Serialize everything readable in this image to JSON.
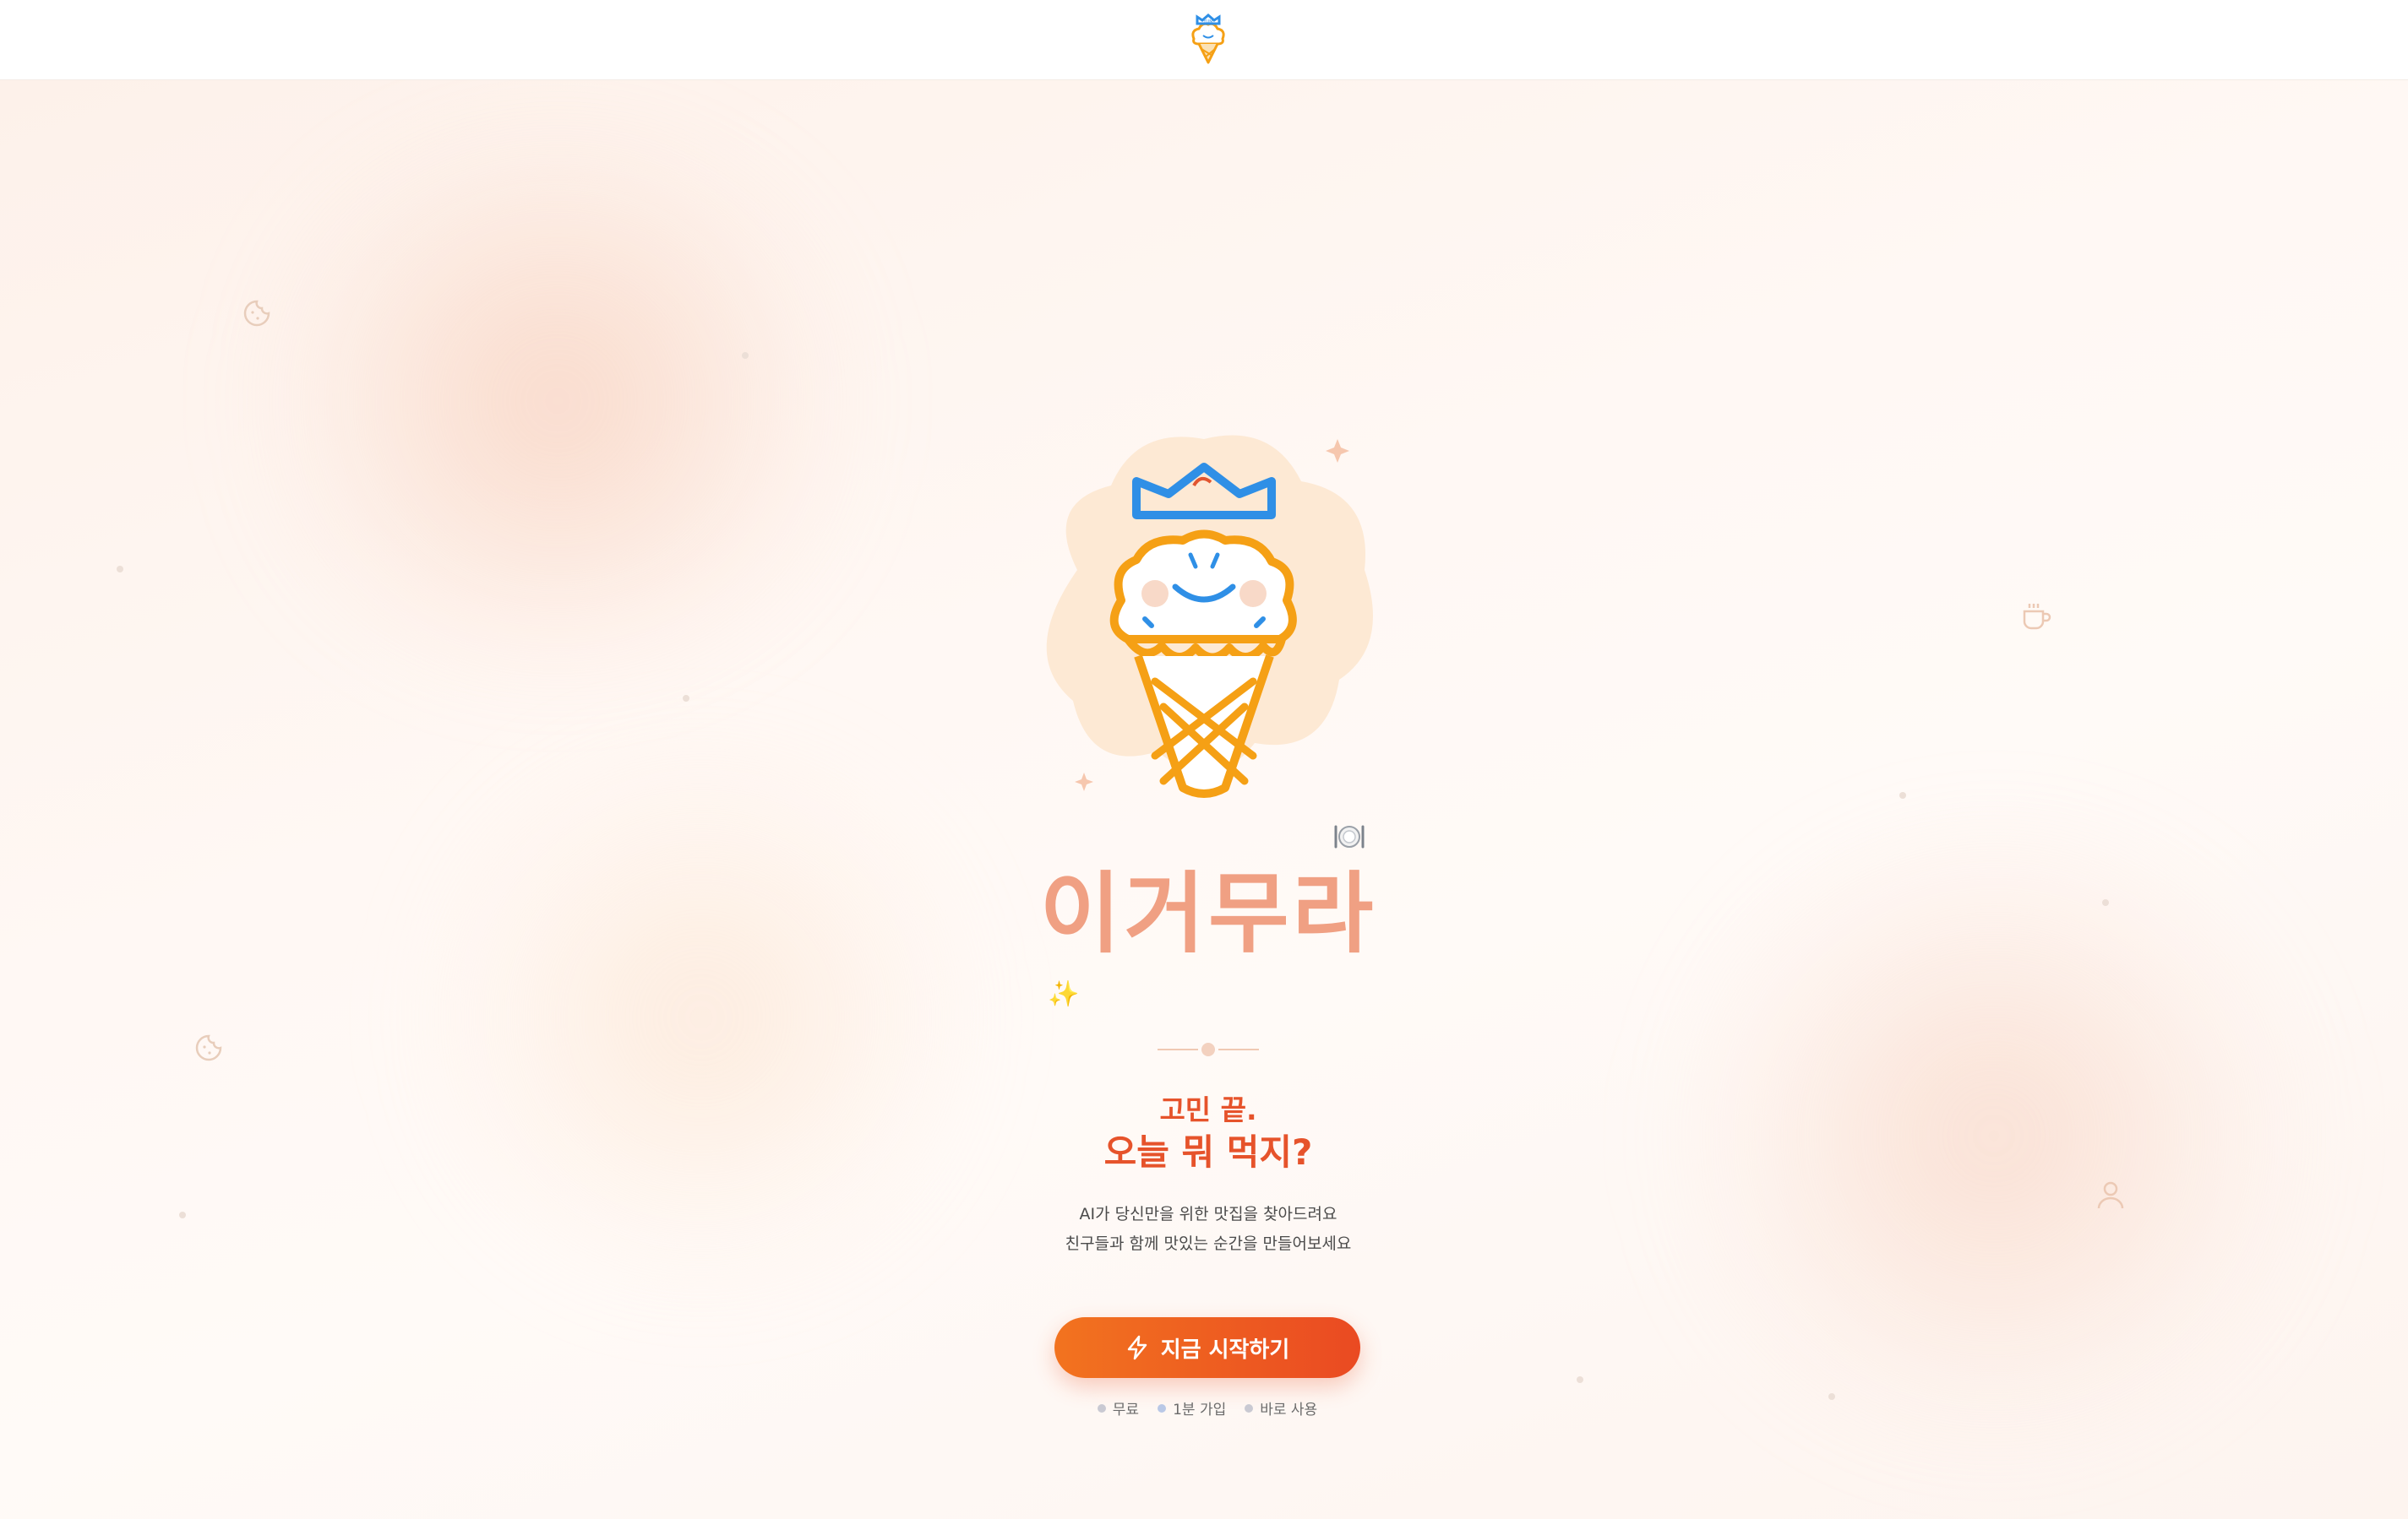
{
  "header": {
    "logo_icon": "ice-cream-mascot-logo"
  },
  "hero": {
    "brand_name": "이거무라",
    "headline_line1": "고민 끝.",
    "headline_line2": "오늘 뭐 먹지?",
    "description_line1": "AI가 당신만을 위한 맛집을 찾아드려요",
    "description_line2": "친구들과 함께 맛있는 순간을 만들어보세요",
    "cta_label": "지금 시작하기",
    "cta_icon": "lightning-icon",
    "tags": [
      "무료",
      "1분 가입",
      "바로 사용"
    ],
    "sparkle": "✨"
  },
  "colors": {
    "accent": "#e6532b",
    "cta_start": "#f2731f",
    "cta_end": "#ea4a22",
    "brand_text": "#f0a083",
    "mascot_cone": "#f5a015",
    "mascot_crown": "#2f8fe6"
  }
}
